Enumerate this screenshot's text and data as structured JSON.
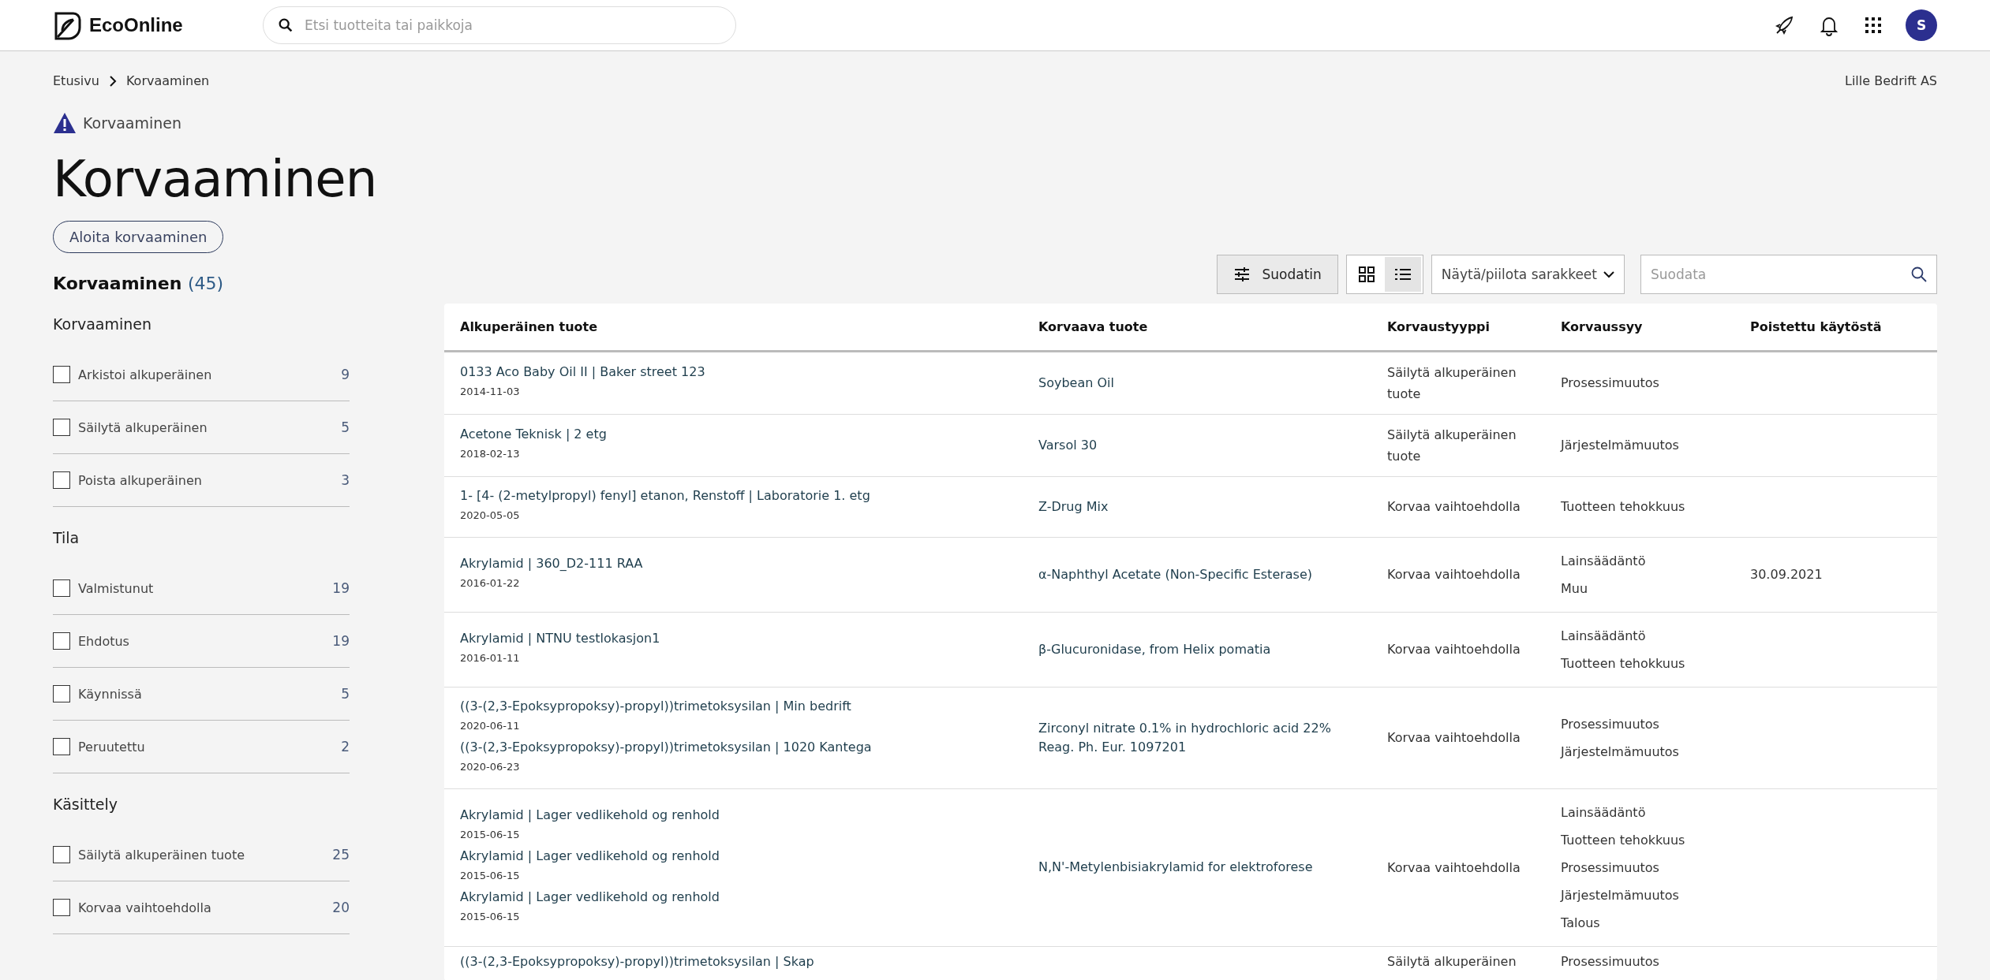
{
  "header": {
    "logo": "EcoOnline",
    "search": {
      "placeholder": "Etsi tuotteita tai paikkoja"
    },
    "avatar": "S"
  },
  "breadcrumb": [
    "Etusivu",
    "Korvaaminen"
  ],
  "company": "Lille Bedrift AS",
  "module_label": "Korvaaminen",
  "title": "Korvaaminen",
  "start_button": "Aloita korvaaminen",
  "sidebar": {
    "heading": "Korvaaminen",
    "count": "(45)",
    "groups": [
      {
        "title": "Korvaaminen",
        "items": [
          {
            "label": "Arkistoi alkuperäinen",
            "count": "9",
            "checked": false
          },
          {
            "label": "Säilytä alkuperäinen",
            "count": "5",
            "checked": false
          },
          {
            "label": "Poista alkuperäinen",
            "count": "3",
            "checked": false
          }
        ]
      },
      {
        "title": "Tila",
        "items": [
          {
            "label": "Valmistunut",
            "count": "19",
            "checked": false
          },
          {
            "label": "Ehdotus",
            "count": "19",
            "checked": false
          },
          {
            "label": "Käynnissä",
            "count": "5",
            "checked": false
          },
          {
            "label": "Peruutettu",
            "count": "2",
            "checked": false
          }
        ]
      },
      {
        "title": "Käsittely",
        "items": [
          {
            "label": "Säilytä alkuperäinen tuote",
            "count": "25",
            "checked": false
          },
          {
            "label": "Korvaa vaihtoehdolla",
            "count": "20",
            "checked": false
          }
        ]
      }
    ]
  },
  "toolbar": {
    "filter_button": "Suodatin",
    "views": [
      {
        "kind": "grid",
        "selected": false
      },
      {
        "kind": "list",
        "selected": true
      }
    ],
    "columns_dropdown": "Näytä/piilota sarakkeet",
    "filter_field": {
      "placeholder": "Suodata"
    }
  },
  "table": {
    "columns": [
      "Alkuperäinen tuote",
      "Korvaava tuote",
      "Korvaustyyppi",
      "Korvaussyy",
      "Poistettu käytöstä"
    ],
    "rows": [
      {
        "originals": [
          {
            "name": "0133 Aco Baby Oil II | Baker street 123",
            "date": "2014-11-03"
          }
        ],
        "replacement": "Soybean Oil",
        "type": "Säilytä alkuperäinen tuote",
        "reasons": [
          "Prosessimuutos"
        ]
      },
      {
        "originals": [
          {
            "name": "Acetone Teknisk | 2 etg",
            "date": "2018-02-13"
          }
        ],
        "replacement": "Varsol 30",
        "type": "Säilytä alkuperäinen tuote",
        "reasons": [
          "Järjestelmämuutos"
        ]
      },
      {
        "originals": [
          {
            "name": "1- [4- (2-metylpropyl) fenyl] etanon, Renstoff | Laboratorie 1. etg",
            "date": "2020-05-05"
          }
        ],
        "replacement": "Z-Drug Mix",
        "type": "Korvaa vaihtoehdolla",
        "reasons": [
          "Tuotteen tehokkuus"
        ]
      },
      {
        "originals": [
          {
            "name": "Akrylamid | 360_D2-111 RAA",
            "date": "2016-01-22"
          }
        ],
        "replacement": "α-Naphthyl Acetate (Non-Specific Esterase)",
        "type": "Korvaa vaihtoehdolla",
        "reasons": [
          "Lainsäädäntö",
          "Muu"
        ],
        "removed": "30.09.2021"
      },
      {
        "originals": [
          {
            "name": "Akrylamid | NTNU testlokasjon1",
            "date": "2016-01-11"
          }
        ],
        "replacement": "β-Glucuronidase, from Helix pomatia",
        "type": "Korvaa vaihtoehdolla",
        "reasons": [
          "Lainsäädäntö",
          "Tuotteen tehokkuus"
        ]
      },
      {
        "originals": [
          {
            "name": "((3-(2,3-Epoksypropoksy)-propyl))trimetoksysilan | Min bedrift",
            "date": "2020-06-11"
          },
          {
            "name": "((3-(2,3-Epoksypropoksy)-propyl))trimetoksysilan | 1020 Kantega",
            "date": "2020-06-23"
          }
        ],
        "replacement": "Zirconyl nitrate 0.1% in hydrochloric acid 22% Reag. Ph. Eur. 1097201",
        "type": "Korvaa vaihtoehdolla",
        "reasons": [
          "Prosessimuutos",
          "Järjestelmämuutos"
        ]
      },
      {
        "originals": [
          {
            "name": "Akrylamid | Lager vedlikehold og renhold",
            "date": "2015-06-15"
          },
          {
            "name": "Akrylamid | Lager vedlikehold og renhold",
            "date": "2015-06-15"
          },
          {
            "name": "Akrylamid | Lager vedlikehold og renhold",
            "date": "2015-06-15"
          }
        ],
        "replacement": "N,N'-Metylenbisiakrylamid for elektroforese",
        "type": "Korvaa vaihtoehdolla",
        "reasons": [
          "Lainsäädäntö",
          "Tuotteen tehokkuus",
          "Prosessimuutos",
          "Järjestelmämuutos",
          "Talous"
        ]
      },
      {
        "originals": [
          {
            "name": "((3-(2,3-Epoksypropoksy)-propyl))trimetoksysilan | Skap"
          }
        ],
        "type": "Säilytä alkuperäinen",
        "reasons": [
          "Prosessimuutos"
        ]
      }
    ]
  }
}
